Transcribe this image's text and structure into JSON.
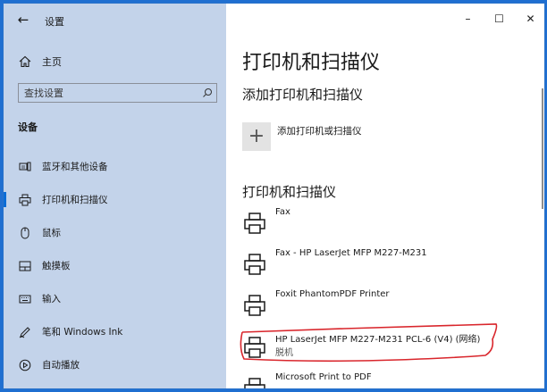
{
  "window": {
    "app_title": "设置",
    "back_glyph": "←",
    "minimize_glyph": "–",
    "maximize_glyph": "☐",
    "close_glyph": "✕"
  },
  "sidebar": {
    "home_label": "主页",
    "search_placeholder": "查找设置",
    "section_label": "设备",
    "items": [
      {
        "label": "蓝牙和其他设备",
        "icon": "bluetooth-devices-icon",
        "active": false
      },
      {
        "label": "打印机和扫描仪",
        "icon": "printer-icon",
        "active": true
      },
      {
        "label": "鼠标",
        "icon": "mouse-icon",
        "active": false
      },
      {
        "label": "触摸板",
        "icon": "touchpad-icon",
        "active": false
      },
      {
        "label": "输入",
        "icon": "keyboard-icon",
        "active": false
      },
      {
        "label": "笔和 Windows Ink",
        "icon": "pen-icon",
        "active": false
      },
      {
        "label": "自动播放",
        "icon": "autoplay-icon",
        "active": false
      }
    ]
  },
  "main": {
    "page_title": "打印机和扫描仪",
    "add_section_title": "添加打印机和扫描仪",
    "add_button_label": "添加打印机或扫描仪",
    "add_button_glyph": "+",
    "printers_section_title": "打印机和扫描仪",
    "printers": [
      {
        "name": "Fax",
        "status": ""
      },
      {
        "name": "Fax - HP LaserJet MFP M227-M231",
        "status": ""
      },
      {
        "name": "Foxit PhantomPDF Printer",
        "status": ""
      },
      {
        "name": "HP LaserJet MFP M227-M231 PCL-6 (V4) (网络)",
        "status": "脱机"
      },
      {
        "name": "Microsoft Print to PDF",
        "status": ""
      }
    ]
  },
  "colors": {
    "accent": "#0a6cd6",
    "sidebar_bg": "#c3d3ea",
    "annotation": "#d9262c"
  }
}
